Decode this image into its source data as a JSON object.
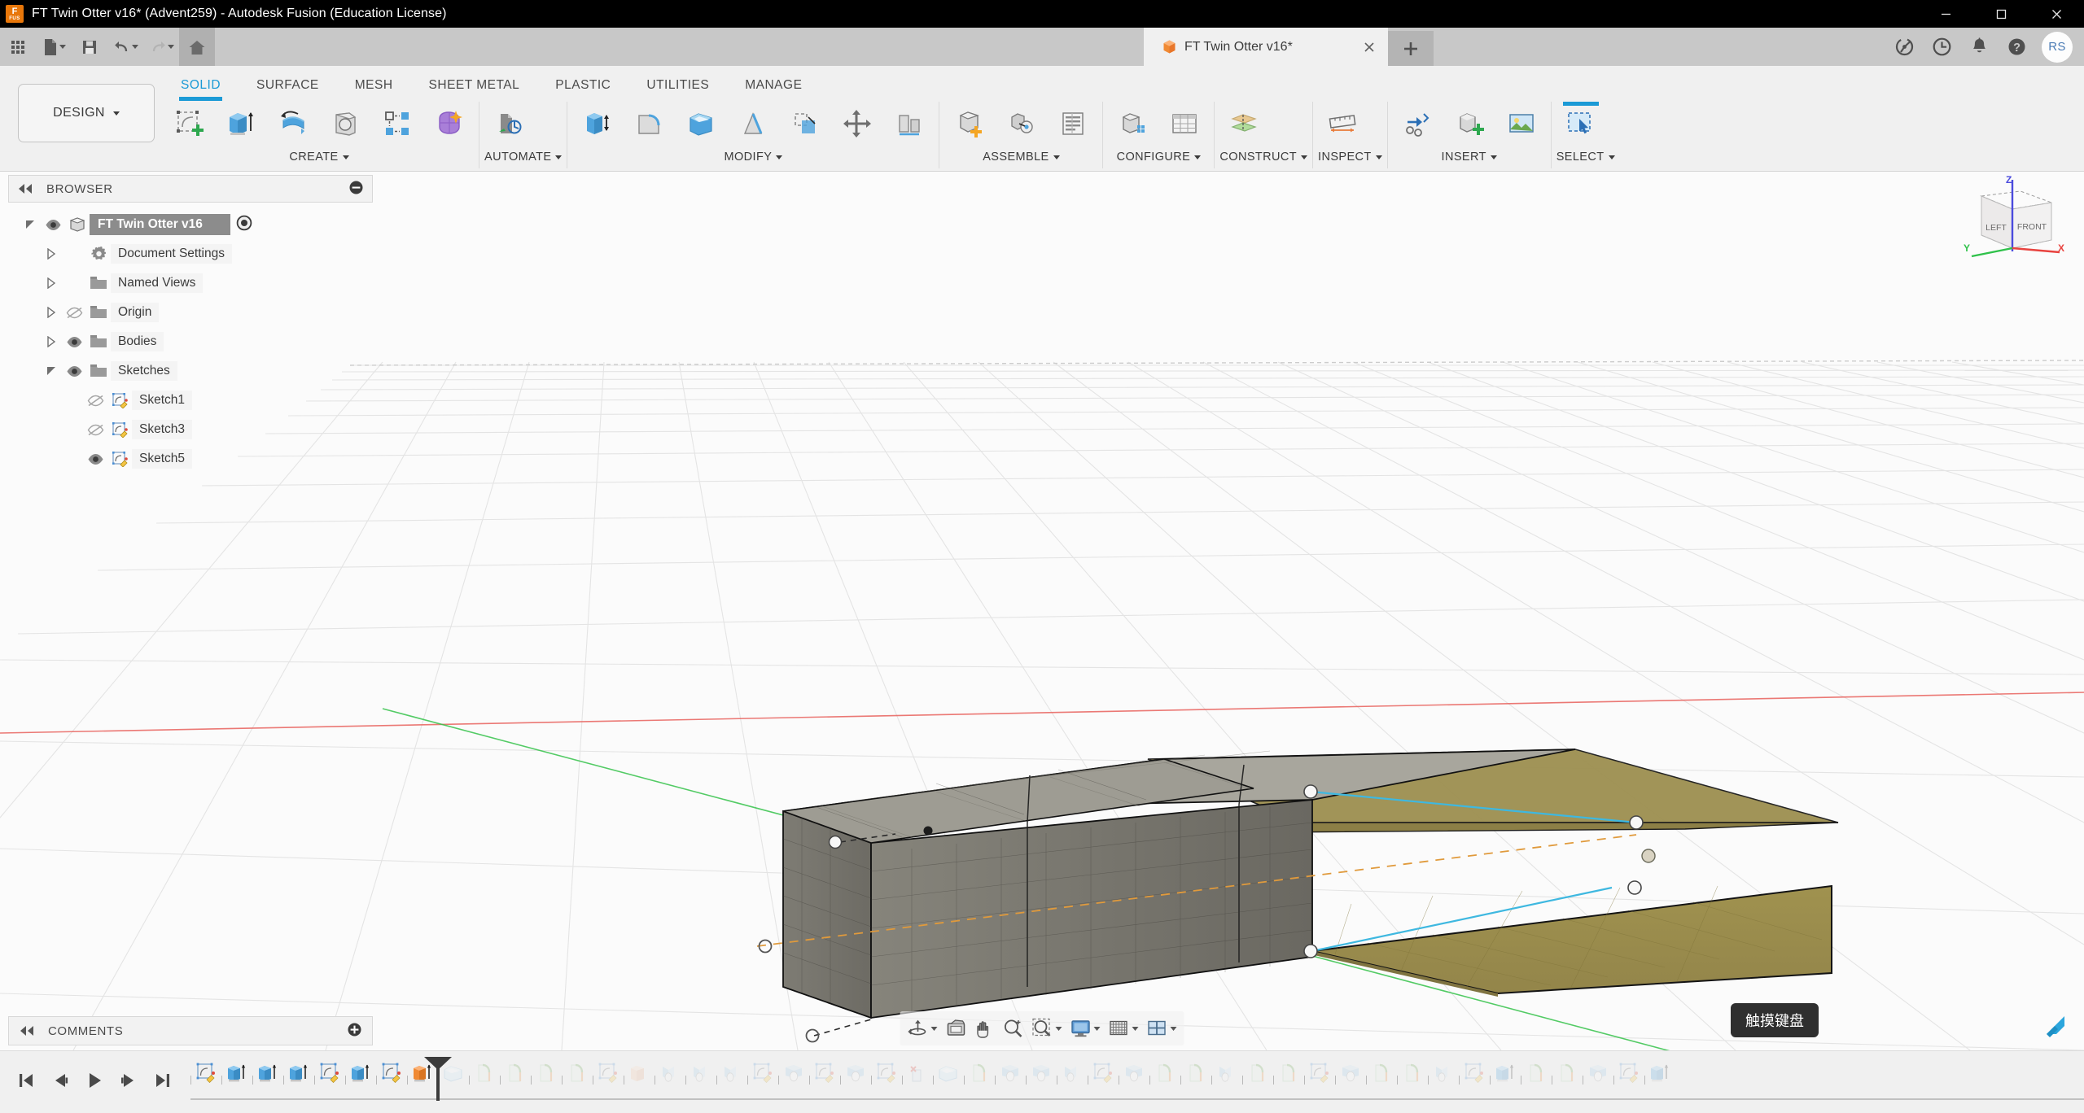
{
  "window": {
    "title": "FT Twin Otter v16* (Advent259) - Autodesk Fusion (Education License)",
    "logo_line1": "F",
    "logo_line2": "FUS",
    "minimize_icon": "minimize-icon",
    "maximize_icon": "maximize-icon",
    "close_icon": "close-icon"
  },
  "quick_access": {
    "app_grid_icon": "app-grid-icon",
    "new_icon": "new-document-icon",
    "save_icon": "save-icon",
    "undo_icon": "undo-icon",
    "redo_icon": "redo-icon",
    "home_icon": "home-icon",
    "document_tab": {
      "label": "FT Twin Otter v16*",
      "icon": "orange-cube-icon",
      "close_icon": "close-icon"
    },
    "new_tab_icon": "plus-icon",
    "right_icons": [
      {
        "name": "extension-icon",
        "glyph": "extension"
      },
      {
        "name": "history-clock-icon",
        "glyph": "clock"
      },
      {
        "name": "notification-bell-icon",
        "glyph": "bell"
      },
      {
        "name": "help-icon",
        "glyph": "question"
      }
    ],
    "avatar_initials": "RS"
  },
  "ribbon": {
    "workspace_selector": "DESIGN",
    "tabs": [
      {
        "label": "SOLID",
        "active": true
      },
      {
        "label": "SURFACE",
        "active": false
      },
      {
        "label": "MESH",
        "active": false
      },
      {
        "label": "SHEET METAL",
        "active": false
      },
      {
        "label": "PLASTIC",
        "active": false
      },
      {
        "label": "UTILITIES",
        "active": false
      },
      {
        "label": "MANAGE",
        "active": false
      }
    ],
    "panels": [
      {
        "label": "CREATE",
        "has_dropdown": true,
        "tools": [
          "create-sketch-icon",
          "extrude-icon",
          "revolve-icon",
          "sweep-icon",
          "pattern-icon",
          "form-icon"
        ]
      },
      {
        "label": "AUTOMATE",
        "has_dropdown": true,
        "tools": [
          "automate-icon"
        ]
      },
      {
        "label": "MODIFY",
        "has_dropdown": true,
        "tools": [
          "press-pull-icon",
          "fillet-icon",
          "shell-icon",
          "draft-icon",
          "scale-icon",
          "move-copy-icon",
          "align-icon"
        ]
      },
      {
        "label": "ASSEMBLE",
        "has_dropdown": true,
        "tools": [
          "new-component-icon",
          "joint-icon",
          "assemble-list-icon"
        ]
      },
      {
        "label": "CONFIGURE",
        "has_dropdown": true,
        "tools": [
          "configure-icon",
          "configure-table-icon"
        ]
      },
      {
        "label": "CONSTRUCT",
        "has_dropdown": true,
        "tools": [
          "offset-plane-icon"
        ]
      },
      {
        "label": "INSPECT",
        "has_dropdown": true,
        "tools": [
          "measure-icon"
        ]
      },
      {
        "label": "INSERT",
        "has_dropdown": true,
        "tools": [
          "insert-derive-icon",
          "insert-mcmaster-icon",
          "insert-canvas-icon"
        ]
      },
      {
        "label": "SELECT",
        "has_dropdown": true,
        "tools": [
          "select-icon"
        ]
      }
    ]
  },
  "browser": {
    "title": "BROWSER",
    "collapse_icon": "collapse-left-icon",
    "minimize_icon": "minus-circle-icon",
    "items": [
      {
        "label": "FT Twin Otter v16",
        "indent": 0,
        "twisty": "expanded",
        "eye": "visible",
        "icon": "component-icon",
        "selected": true,
        "has_radio": true
      },
      {
        "label": "Document Settings",
        "indent": 1,
        "twisty": "collapsed",
        "eye": "none",
        "icon": "gear-icon",
        "selected": false
      },
      {
        "label": "Named Views",
        "indent": 1,
        "twisty": "collapsed",
        "eye": "none",
        "icon": "folder-icon",
        "selected": false
      },
      {
        "label": "Origin",
        "indent": 1,
        "twisty": "collapsed",
        "eye": "hidden",
        "icon": "folder-icon",
        "selected": false
      },
      {
        "label": "Bodies",
        "indent": 1,
        "twisty": "collapsed",
        "eye": "visible",
        "icon": "folder-icon",
        "selected": false
      },
      {
        "label": "Sketches",
        "indent": 1,
        "twisty": "expanded",
        "eye": "visible",
        "icon": "folder-icon",
        "selected": false
      },
      {
        "label": "Sketch1",
        "indent": 2,
        "twisty": "none",
        "eye": "hidden",
        "icon": "sketch-icon",
        "selected": false
      },
      {
        "label": "Sketch3",
        "indent": 2,
        "twisty": "none",
        "eye": "hidden",
        "icon": "sketch-icon",
        "selected": false
      },
      {
        "label": "Sketch5",
        "indent": 2,
        "twisty": "none",
        "eye": "visible",
        "icon": "sketch-icon",
        "selected": false
      }
    ]
  },
  "viewcube": {
    "face_left": "LEFT",
    "face_front": "FRONT",
    "axis_x": "X",
    "axis_y": "Y",
    "axis_z": "Z",
    "color_x": "#e8433f",
    "color_y": "#2fc14a",
    "color_z": "#4b4bdd"
  },
  "comments": {
    "title": "COMMENTS",
    "add_icon": "plus-circle-icon"
  },
  "view_controls": [
    {
      "name": "orbit-icon",
      "has_dropdown": true
    },
    {
      "name": "look-at-icon",
      "has_dropdown": false
    },
    {
      "name": "pan-icon",
      "has_dropdown": false
    },
    {
      "name": "zoom-icon",
      "has_dropdown": false
    },
    {
      "name": "zoom-window-icon",
      "has_dropdown": true
    },
    {
      "name": "display-settings-icon",
      "has_dropdown": true
    },
    {
      "name": "grid-snap-icon",
      "has_dropdown": true
    },
    {
      "name": "viewport-layout-icon",
      "has_dropdown": true
    }
  ],
  "marker_menu_icon": "marker-menu-icon",
  "tooltip": {
    "text": "触摸键盘"
  },
  "timeline": {
    "playback": [
      "go-to-beginning-icon",
      "step-back-icon",
      "play-icon",
      "step-forward-icon",
      "go-to-end-icon"
    ],
    "features": [
      {
        "icon": "sketch-icon",
        "state": "active"
      },
      {
        "icon": "extrude-icon",
        "state": "active"
      },
      {
        "icon": "extrude-icon",
        "state": "active"
      },
      {
        "icon": "extrude-icon",
        "state": "active"
      },
      {
        "icon": "sketch-icon",
        "state": "active"
      },
      {
        "icon": "extrude-icon",
        "state": "active"
      },
      {
        "icon": "sketch-icon",
        "state": "active"
      },
      {
        "icon": "extrude-orange-icon",
        "state": "current"
      },
      {
        "icon": "shell-icon",
        "state": "faded"
      },
      {
        "icon": "fillet-icon",
        "state": "faded"
      },
      {
        "icon": "fillet-icon",
        "state": "faded"
      },
      {
        "icon": "fillet-icon",
        "state": "faded"
      },
      {
        "icon": "fillet-icon",
        "state": "faded"
      },
      {
        "icon": "sketch-icon",
        "state": "faded"
      },
      {
        "icon": "extrude-peach-icon",
        "state": "faded"
      },
      {
        "icon": "mirror-icon",
        "state": "faded"
      },
      {
        "icon": "mirror-icon",
        "state": "faded"
      },
      {
        "icon": "mirror-icon",
        "state": "faded"
      },
      {
        "icon": "sketch-icon",
        "state": "faded"
      },
      {
        "icon": "revolve-icon",
        "state": "faded"
      },
      {
        "icon": "sketch-icon",
        "state": "faded"
      },
      {
        "icon": "revolve-icon",
        "state": "faded"
      },
      {
        "icon": "sketch-icon",
        "state": "faded"
      },
      {
        "icon": "delete-icon",
        "state": "faded"
      },
      {
        "icon": "shell-icon",
        "state": "faded"
      },
      {
        "icon": "fillet-icon",
        "state": "faded"
      },
      {
        "icon": "revolve-icon",
        "state": "faded"
      },
      {
        "icon": "revolve-icon",
        "state": "faded"
      },
      {
        "icon": "mirror-icon",
        "state": "faded"
      },
      {
        "icon": "sketch-icon",
        "state": "faded"
      },
      {
        "icon": "revolve-icon",
        "state": "faded"
      },
      {
        "icon": "fillet-icon",
        "state": "faded"
      },
      {
        "icon": "fillet-icon",
        "state": "faded"
      },
      {
        "icon": "mirror-icon",
        "state": "faded"
      },
      {
        "icon": "fillet-icon",
        "state": "faded"
      },
      {
        "icon": "fillet-icon",
        "state": "faded"
      },
      {
        "icon": "sketch-icon",
        "state": "faded"
      },
      {
        "icon": "revolve-icon",
        "state": "faded"
      },
      {
        "icon": "fillet-icon",
        "state": "faded"
      },
      {
        "icon": "fillet-icon",
        "state": "faded"
      },
      {
        "icon": "mirror-icon",
        "state": "faded"
      },
      {
        "icon": "sketch-icon",
        "state": "faded"
      },
      {
        "icon": "extrude-icon",
        "state": "faded"
      },
      {
        "icon": "fillet-icon",
        "state": "faded"
      },
      {
        "icon": "fillet-icon",
        "state": "faded"
      },
      {
        "icon": "revolve-icon",
        "state": "faded"
      },
      {
        "icon": "sketch-icon",
        "state": "faded"
      },
      {
        "icon": "extrude-icon",
        "state": "faded"
      }
    ],
    "playhead_after_index": 7,
    "end_icon": "timeline-end-icon"
  },
  "model": {
    "description": "3D perspective view of an RC aircraft fuselage block with wing and tail surfaces",
    "fuselage_color": "#7d7a72",
    "wing_color": "#9d8f50",
    "sketch_line_color": "#3eb8e0",
    "axis_red": "#e8605c",
    "axis_green": "#35c24a",
    "axis_orange": "#e09a3c"
  }
}
